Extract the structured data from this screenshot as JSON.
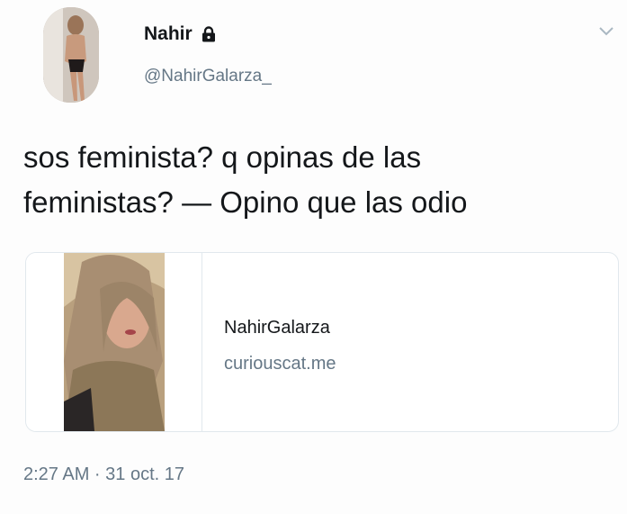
{
  "author": {
    "display_name": "Nahir",
    "handle": "@NahirGalarza_",
    "protected_icon": "lock-icon"
  },
  "menu_icon": "chevron-down-icon",
  "tweet": {
    "text_line_1": "sos feminista? q opinas de las",
    "text_line_2": "feministas? — Opino que las odio",
    "timestamp": "2:27 AM · 31 oct. 17"
  },
  "card": {
    "title": "NahirGalarza",
    "domain": "curiouscat.me"
  },
  "colors": {
    "text_primary": "#14171a",
    "text_secondary": "#657786",
    "border": "#e1e8ed"
  }
}
